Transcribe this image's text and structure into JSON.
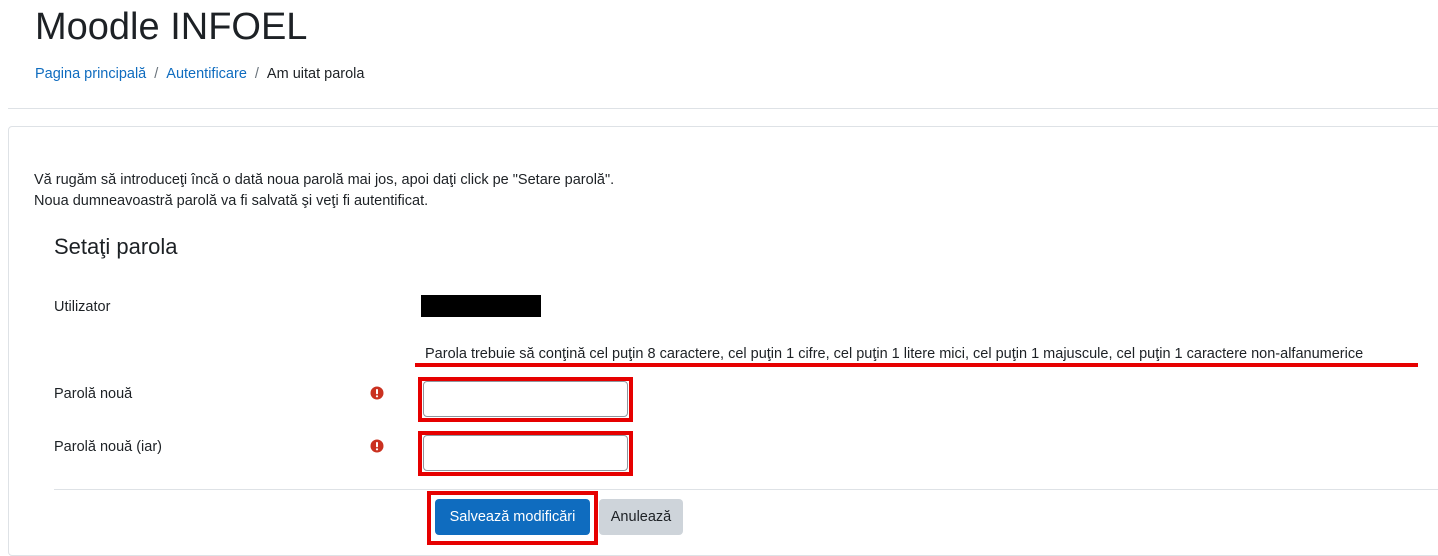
{
  "header": {
    "site_title": "Moodle INFOEL",
    "breadcrumb": {
      "home": "Pagina principală",
      "login": "Autentificare",
      "current": "Am uitat parola",
      "separator": "/"
    }
  },
  "intro": {
    "line1": "Vă rugăm să introduceţi încă o dată noua parolă mai jos, apoi daţi click pe \"Setare parolă\".",
    "line2": "Noua dumneavoastră parolă va fi salvată şi veţi fi autentificat."
  },
  "form": {
    "legend": "Setaţi parola",
    "username_label": "Utilizator",
    "password_policy": "Parola trebuie să conţină cel puţin 8 caractere, cel puţin 1 cifre, cel puţin 1 litere mici, cel puţin 1 majuscule, cel puţin 1 caractere non-alfanumerice",
    "new_password_label": "Parolă nouă",
    "new_password_value": "",
    "new_password_repeat_label": "Parolă nouă (iar)",
    "new_password_repeat_value": "",
    "required_icon": "exclamation-circle-icon",
    "save_label": "Salvează modificări",
    "cancel_label": "Anulează"
  },
  "colors": {
    "link": "#0f6cbf",
    "primary_button": "#0f6cbf",
    "secondary_button": "#ced4da",
    "required_icon": "#ca3120",
    "annotation_highlight": "#e60000"
  }
}
